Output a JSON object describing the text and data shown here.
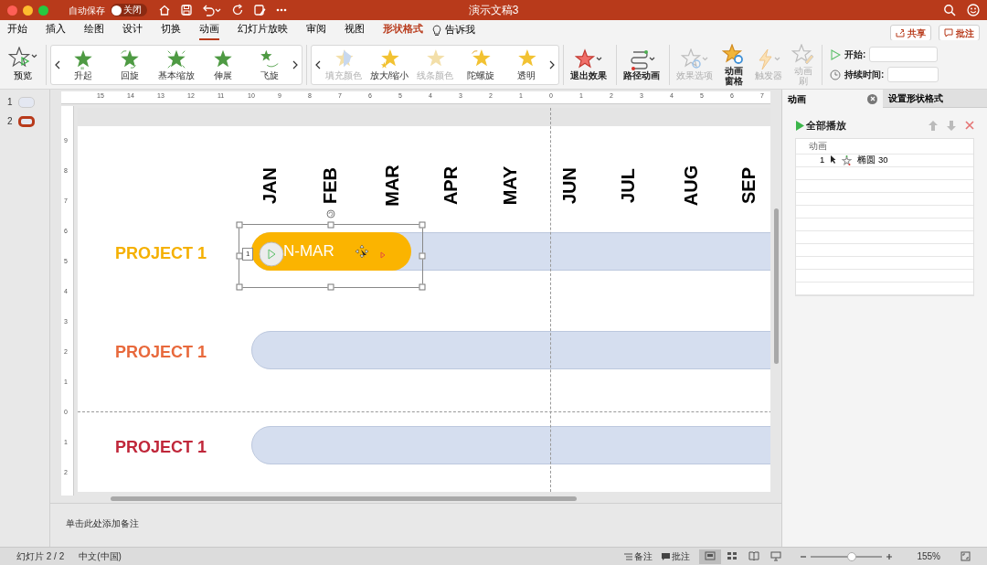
{
  "window": {
    "title": "演示文稿3",
    "autosave": "自动保存",
    "autosave_toggle": {
      "label": "关闭",
      "on": false
    }
  },
  "menu_tabs": [
    {
      "label": "开始",
      "selected": false,
      "kind": "normal"
    },
    {
      "label": "插入",
      "selected": false,
      "kind": "normal"
    },
    {
      "label": "绘图",
      "selected": false,
      "kind": "normal"
    },
    {
      "label": "设计",
      "selected": false,
      "kind": "normal"
    },
    {
      "label": "切换",
      "selected": false,
      "kind": "normal"
    },
    {
      "label": "动画",
      "selected": true,
      "kind": "normal"
    },
    {
      "label": "幻灯片放映",
      "selected": false,
      "kind": "normal"
    },
    {
      "label": "审阅",
      "selected": false,
      "kind": "normal"
    },
    {
      "label": "视图",
      "selected": false,
      "kind": "normal"
    },
    {
      "label": "形状格式",
      "selected": false,
      "kind": "contextual"
    }
  ],
  "tell_me": "告诉我",
  "header_buttons": [
    "共享",
    "批注"
  ],
  "ribbon": {
    "preview": "预览",
    "entrance_effects": [
      {
        "label": "升起"
      },
      {
        "label": "回旋"
      },
      {
        "label": "基本缩放"
      },
      {
        "label": "伸展"
      },
      {
        "label": "飞旋"
      }
    ],
    "emphasis_effects": [
      {
        "label": "填充颜色",
        "disabled": true
      },
      {
        "label": "放大/缩小",
        "disabled": false
      },
      {
        "label": "线条颜色",
        "disabled": true
      },
      {
        "label": "陀螺旋",
        "disabled": false
      },
      {
        "label": "透明",
        "disabled": false
      }
    ],
    "buttons": [
      {
        "label": "退出效果",
        "disabled": false,
        "kind": "exit"
      },
      {
        "label": "路径动画",
        "disabled": false,
        "kind": "path"
      },
      {
        "label": "效果选项",
        "disabled": true,
        "kind": "options"
      },
      {
        "label": "动画窗格",
        "disabled": false,
        "kind": "pane"
      },
      {
        "label": "触发器",
        "disabled": true,
        "kind": "trigger"
      },
      {
        "label": "动画刷",
        "disabled": true,
        "kind": "painter"
      }
    ],
    "timing": [
      {
        "label": "开始:",
        "kind": "start"
      },
      {
        "label": "持续时间:",
        "kind": "duration"
      }
    ]
  },
  "slides": [
    {
      "number": "1",
      "selected": false
    },
    {
      "number": "2",
      "selected": true
    }
  ],
  "ruler": {
    "horizontal": [
      "15",
      "14",
      "13",
      "12",
      "11",
      "10",
      "9",
      "8",
      "7",
      "6",
      "5",
      "4",
      "3",
      "2",
      "1",
      "0",
      "1",
      "2",
      "3",
      "4",
      "5",
      "6",
      "7"
    ],
    "vertical": [
      "9",
      "8",
      "7",
      "6",
      "5",
      "4",
      "3",
      "2",
      "1",
      "0",
      "1",
      "2"
    ]
  },
  "slide": {
    "months": [
      "JAN",
      "FEB",
      "MAR",
      "APR",
      "MAY",
      "JUN",
      "JUL",
      "AUG",
      "SEP"
    ],
    "projects": [
      {
        "label": "PROJECT 1",
        "color": "#f5b000",
        "bar_text": "N-MAR"
      },
      {
        "label": "PROJECT 1",
        "color": "#e8693c"
      },
      {
        "label": "PROJECT 1",
        "color": "#c0273a"
      }
    ],
    "animation_tag": "1"
  },
  "animation_pane": {
    "tabs": [
      {
        "label": "动画",
        "selected": true
      },
      {
        "label": "设置形状格式",
        "selected": false
      }
    ],
    "play_all": "全部播放",
    "list_header": "动画",
    "items": [
      {
        "number": "1",
        "name": "椭圆 30"
      }
    ]
  },
  "notes_placeholder": "单击此处添加备注",
  "status_bar": {
    "slide": "幻灯片 2 / 2",
    "language": "中文(中国)",
    "notes": "备注",
    "comments": "批注",
    "views": [
      {
        "selected": true
      },
      {
        "selected": false
      },
      {
        "selected": false
      },
      {
        "selected": false
      }
    ],
    "zoom": {
      "level": 0.57,
      "reading": "155%"
    }
  }
}
